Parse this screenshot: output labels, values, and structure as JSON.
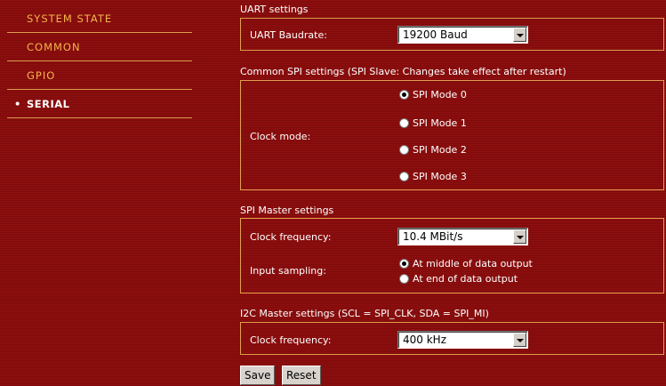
{
  "nav": {
    "items": [
      {
        "label": "SYSTEM STATE"
      },
      {
        "label": "COMMON"
      },
      {
        "label": "GPIO"
      },
      {
        "label": "SERIAL"
      }
    ],
    "active_bullet": "•"
  },
  "uart": {
    "title": "UART settings",
    "baudrate_label": "UART Baudrate:",
    "baudrate_value": "19200 Baud"
  },
  "spi_common": {
    "title": "Common SPI settings (SPI Slave: Changes take effect after restart)",
    "clock_mode_label": "Clock mode:",
    "modes": [
      {
        "label": "SPI Mode 0",
        "checked": true
      },
      {
        "label": "SPI Mode 1",
        "checked": false
      },
      {
        "label": "SPI Mode 2",
        "checked": false
      },
      {
        "label": "SPI Mode 3",
        "checked": false
      }
    ]
  },
  "spi_master": {
    "title": "SPI Master settings",
    "clock_label": "Clock frequency:",
    "clock_value": "10.4 MBit/s",
    "sampling_label": "Input sampling:",
    "sampling_options": [
      {
        "label": "At middle of data output",
        "checked": true
      },
      {
        "label": "At end of data output",
        "checked": false
      }
    ]
  },
  "i2c_master": {
    "title": "I2C Master settings (SCL = SPI_CLK, SDA = SPI_MI)",
    "clock_label": "Clock frequency:",
    "clock_value": "400 kHz"
  },
  "buttons": {
    "save": "Save",
    "reset": "Reset"
  },
  "colors": {
    "background": "#8a0e0e",
    "border": "#e0a050",
    "nav_text": "#f2b54a"
  }
}
